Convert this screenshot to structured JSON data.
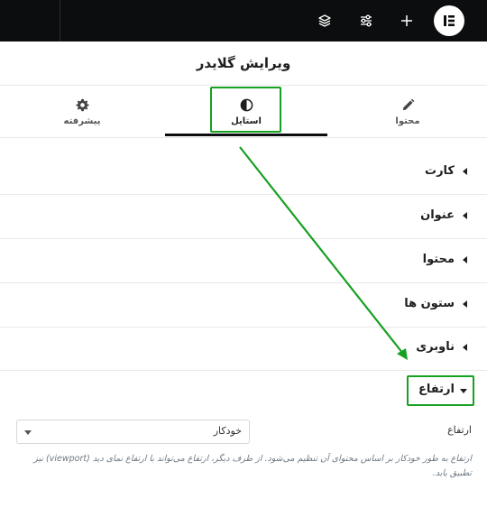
{
  "header": {
    "title": "ویرایش گلایدر"
  },
  "topbar": {
    "icons": [
      "elementor-logo-icon",
      "plus-icon",
      "sliders-icon",
      "layers-icon"
    ]
  },
  "tabs": [
    {
      "label": "پیشرفته",
      "icon": "gear-icon"
    },
    {
      "label": "استایل",
      "icon": "contrast-icon"
    },
    {
      "label": "محتوا",
      "icon": "pencil-icon"
    }
  ],
  "active_tab": "استایل",
  "sections": [
    {
      "label": "کارت"
    },
    {
      "label": "عنوان"
    },
    {
      "label": "محتوا"
    },
    {
      "label": "ستون ها"
    },
    {
      "label": "ناوبری"
    }
  ],
  "open_section": {
    "label": "ارتفاع"
  },
  "height_control": {
    "label": "ارتفاع",
    "value": "خودکار",
    "help": "ارتفاع به طور خودکار بر اساس محتوای آن تنظیم می‌شود. از طرف دیگر، ارتفاع می‌تواند با ارتفاع نمای دید (viewport) نیز تطبیق یابد."
  },
  "colors": {
    "topbar_bg": "#0c0d0e",
    "highlight": "#16a021",
    "divider": "#e6e8ea",
    "text": "#1f1f1f"
  }
}
